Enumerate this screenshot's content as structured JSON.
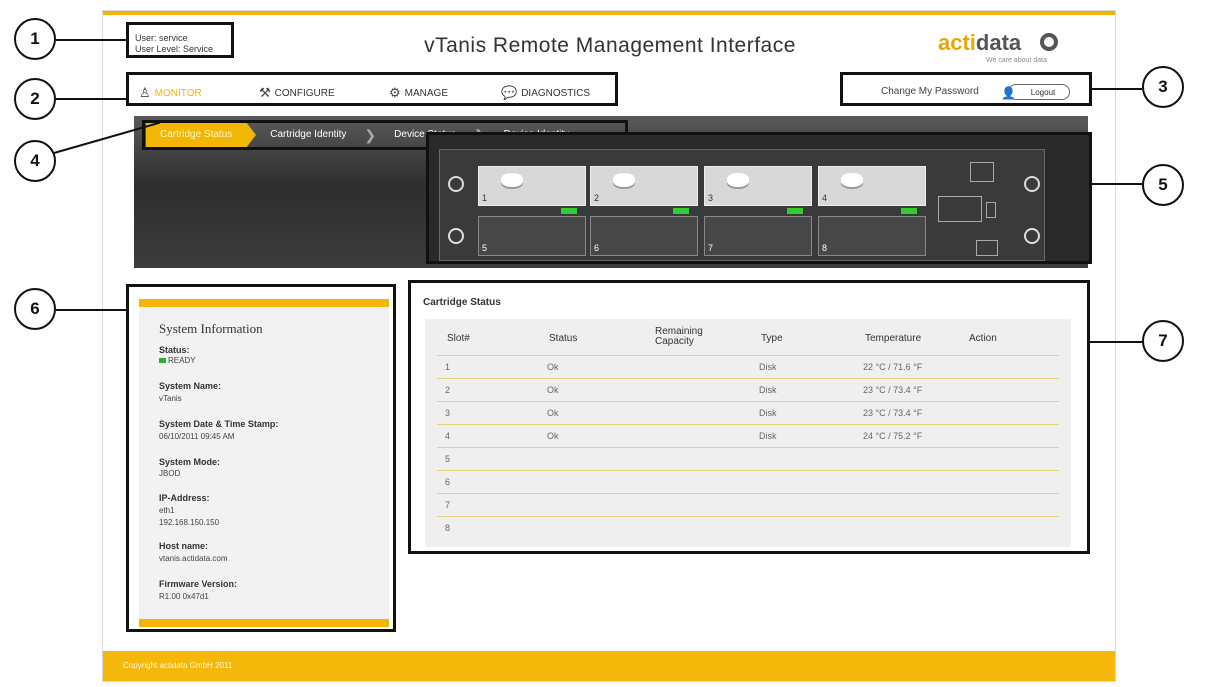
{
  "header": {
    "user_line1": "User: service",
    "user_line2": "User Level: Service",
    "title": "vTanis Remote Management Interface",
    "logo_text_a": "acti",
    "logo_text_b": "data",
    "tagline": "We care about data"
  },
  "nav": {
    "items": [
      {
        "label": "MONITOR",
        "icon": "monitor-icon",
        "active": true
      },
      {
        "label": "CONFIGURE",
        "icon": "wrench-icon",
        "active": false
      },
      {
        "label": "MANAGE",
        "icon": "network-icon",
        "active": false
      },
      {
        "label": "DIAGNOSTICS",
        "icon": "chat-icon",
        "active": false
      }
    ]
  },
  "account": {
    "change_password": "Change My Password",
    "logout": "Logout",
    "logout_icon": "user-icon"
  },
  "breadcrumbs": [
    "Cartridge Status",
    "Cartridge Identity",
    "Device Status",
    "Device Identity"
  ],
  "device": {
    "slots": [
      {
        "num": "1",
        "filled": true
      },
      {
        "num": "2",
        "filled": true
      },
      {
        "num": "3",
        "filled": true
      },
      {
        "num": "4",
        "filled": true
      },
      {
        "num": "5",
        "filled": false
      },
      {
        "num": "6",
        "filled": false
      },
      {
        "num": "7",
        "filled": false
      },
      {
        "num": "8",
        "filled": false
      }
    ]
  },
  "system_info": {
    "title": "System Information",
    "status_label": "Status:",
    "status_value": "READY",
    "name_label": "System Name:",
    "name_value": "vTanis",
    "date_label": "System Date & Time Stamp:",
    "date_value": "06/10/2011 09:45 AM",
    "mode_label": "System Mode:",
    "mode_value": "JBOD",
    "ip_label": "IP-Address:",
    "ip_iface": "eth1",
    "ip_value": "192.168.150.150",
    "host_label": "Host name:",
    "host_value": "vtanis.actidata.com",
    "fw_label": "Firmware Version:",
    "fw_value": "R1.00 0x47d1"
  },
  "cartridge_status": {
    "title": "Cartridge Status",
    "columns": [
      "Slot#",
      "Status",
      "Remaining Capacity",
      "Type",
      "Temperature",
      "Action"
    ],
    "rows": [
      {
        "slot": "1",
        "status": "Ok",
        "capacity": "",
        "type": "Disk",
        "temp": "22 °C / 71.6 °F",
        "action": ""
      },
      {
        "slot": "2",
        "status": "Ok",
        "capacity": "",
        "type": "Disk",
        "temp": "23 °C / 73.4 °F",
        "action": ""
      },
      {
        "slot": "3",
        "status": "Ok",
        "capacity": "",
        "type": "Disk",
        "temp": "23 °C / 73.4 °F",
        "action": ""
      },
      {
        "slot": "4",
        "status": "Ok",
        "capacity": "",
        "type": "Disk",
        "temp": "24 °C / 75.2 °F",
        "action": ""
      },
      {
        "slot": "5",
        "status": "",
        "capacity": "",
        "type": "",
        "temp": "",
        "action": ""
      },
      {
        "slot": "6",
        "status": "",
        "capacity": "",
        "type": "",
        "temp": "",
        "action": ""
      },
      {
        "slot": "7",
        "status": "",
        "capacity": "",
        "type": "",
        "temp": "",
        "action": ""
      },
      {
        "slot": "8",
        "status": "",
        "capacity": "",
        "type": "",
        "temp": "",
        "action": ""
      }
    ]
  },
  "footer": {
    "copyright": "Copyright actidata GmbH 2011"
  },
  "callouts": [
    "1",
    "2",
    "3",
    "4",
    "5",
    "6",
    "7"
  ],
  "colors": {
    "accent": "#f2b705",
    "status_ok": "#33aa33"
  }
}
